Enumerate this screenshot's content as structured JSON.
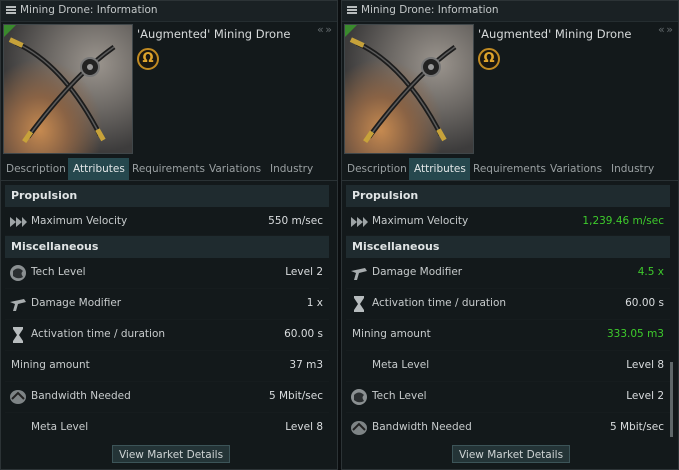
{
  "windows": [
    {
      "title": "Mining Drone: Information",
      "item_name": "'Augmented' Mining Drone",
      "badge": "Ω",
      "tabs": [
        "Description",
        "Attributes",
        "Requirements",
        "Variations",
        "Industry"
      ],
      "active_tab": "Attributes",
      "sections": [
        {
          "header": "Propulsion",
          "rows": [
            {
              "icon": "velocity-icon",
              "label": "Maximum Velocity",
              "value": "550 m/sec",
              "highlight": false
            }
          ]
        },
        {
          "header": "Miscellaneous",
          "rows": [
            {
              "icon": "tech-level-icon",
              "label": "Tech Level",
              "value": "Level 2",
              "highlight": false
            },
            {
              "icon": "damage-modifier-icon",
              "label": "Damage Modifier",
              "value": "1 x",
              "highlight": false
            },
            {
              "icon": "hourglass-icon",
              "label": "Activation time / duration",
              "value": "60.00 s",
              "highlight": false
            },
            {
              "icon": "",
              "label": "Mining amount",
              "value": "37 m3",
              "highlight": false
            },
            {
              "icon": "bandwidth-icon",
              "label": "Bandwidth Needed",
              "value": "5 Mbit/sec",
              "highlight": false
            },
            {
              "icon": "",
              "label": "Meta Level",
              "value": "Level 8",
              "highlight": false
            }
          ]
        }
      ],
      "button": "View Market Details"
    },
    {
      "title": "Mining Drone: Information",
      "item_name": "'Augmented' Mining Drone",
      "badge": "Ω",
      "tabs": [
        "Description",
        "Attributes",
        "Requirements",
        "Variations",
        "Industry"
      ],
      "active_tab": "Attributes",
      "sections": [
        {
          "header": "Propulsion",
          "rows": [
            {
              "icon": "velocity-icon",
              "label": "Maximum Velocity",
              "value": "1,239.46 m/sec",
              "highlight": true
            }
          ]
        },
        {
          "header": "Miscellaneous",
          "rows": [
            {
              "icon": "damage-modifier-icon",
              "label": "Damage Modifier",
              "value": "4.5 x",
              "highlight": true
            },
            {
              "icon": "hourglass-icon",
              "label": "Activation time / duration",
              "value": "60.00 s",
              "highlight": false
            },
            {
              "icon": "",
              "label": "Mining amount",
              "value": "333.05 m3",
              "highlight": true
            },
            {
              "icon": "",
              "label": "Meta Level",
              "value": "Level 8",
              "highlight": false
            },
            {
              "icon": "tech-level-icon",
              "label": "Tech Level",
              "value": "Level 2",
              "highlight": false
            },
            {
              "icon": "bandwidth-icon",
              "label": "Bandwidth Needed",
              "value": "5 Mbit/sec",
              "highlight": false
            }
          ]
        }
      ],
      "button": "View Market Details"
    }
  ],
  "colors": {
    "highlight": "#3ecb2c",
    "active_tab": "#26484e",
    "badge": "#c08a22",
    "panel": "#13191b"
  }
}
